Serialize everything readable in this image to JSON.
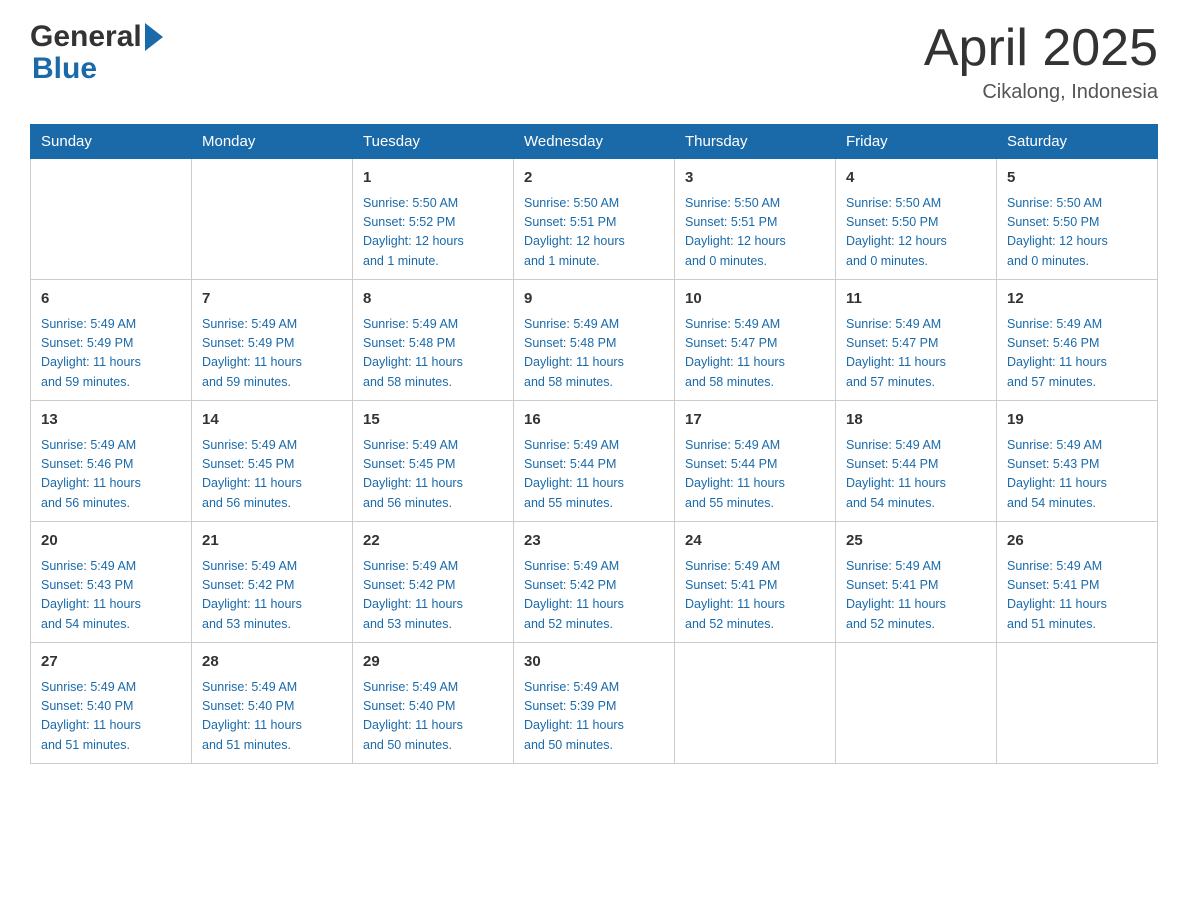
{
  "header": {
    "logo_general": "General",
    "logo_blue": "Blue",
    "title": "April 2025",
    "subtitle": "Cikalong, Indonesia"
  },
  "weekdays": [
    "Sunday",
    "Monday",
    "Tuesday",
    "Wednesday",
    "Thursday",
    "Friday",
    "Saturday"
  ],
  "weeks": [
    [
      {
        "day": "",
        "info": ""
      },
      {
        "day": "",
        "info": ""
      },
      {
        "day": "1",
        "info": "Sunrise: 5:50 AM\nSunset: 5:52 PM\nDaylight: 12 hours\nand 1 minute."
      },
      {
        "day": "2",
        "info": "Sunrise: 5:50 AM\nSunset: 5:51 PM\nDaylight: 12 hours\nand 1 minute."
      },
      {
        "day": "3",
        "info": "Sunrise: 5:50 AM\nSunset: 5:51 PM\nDaylight: 12 hours\nand 0 minutes."
      },
      {
        "day": "4",
        "info": "Sunrise: 5:50 AM\nSunset: 5:50 PM\nDaylight: 12 hours\nand 0 minutes."
      },
      {
        "day": "5",
        "info": "Sunrise: 5:50 AM\nSunset: 5:50 PM\nDaylight: 12 hours\nand 0 minutes."
      }
    ],
    [
      {
        "day": "6",
        "info": "Sunrise: 5:49 AM\nSunset: 5:49 PM\nDaylight: 11 hours\nand 59 minutes."
      },
      {
        "day": "7",
        "info": "Sunrise: 5:49 AM\nSunset: 5:49 PM\nDaylight: 11 hours\nand 59 minutes."
      },
      {
        "day": "8",
        "info": "Sunrise: 5:49 AM\nSunset: 5:48 PM\nDaylight: 11 hours\nand 58 minutes."
      },
      {
        "day": "9",
        "info": "Sunrise: 5:49 AM\nSunset: 5:48 PM\nDaylight: 11 hours\nand 58 minutes."
      },
      {
        "day": "10",
        "info": "Sunrise: 5:49 AM\nSunset: 5:47 PM\nDaylight: 11 hours\nand 58 minutes."
      },
      {
        "day": "11",
        "info": "Sunrise: 5:49 AM\nSunset: 5:47 PM\nDaylight: 11 hours\nand 57 minutes."
      },
      {
        "day": "12",
        "info": "Sunrise: 5:49 AM\nSunset: 5:46 PM\nDaylight: 11 hours\nand 57 minutes."
      }
    ],
    [
      {
        "day": "13",
        "info": "Sunrise: 5:49 AM\nSunset: 5:46 PM\nDaylight: 11 hours\nand 56 minutes."
      },
      {
        "day": "14",
        "info": "Sunrise: 5:49 AM\nSunset: 5:45 PM\nDaylight: 11 hours\nand 56 minutes."
      },
      {
        "day": "15",
        "info": "Sunrise: 5:49 AM\nSunset: 5:45 PM\nDaylight: 11 hours\nand 56 minutes."
      },
      {
        "day": "16",
        "info": "Sunrise: 5:49 AM\nSunset: 5:44 PM\nDaylight: 11 hours\nand 55 minutes."
      },
      {
        "day": "17",
        "info": "Sunrise: 5:49 AM\nSunset: 5:44 PM\nDaylight: 11 hours\nand 55 minutes."
      },
      {
        "day": "18",
        "info": "Sunrise: 5:49 AM\nSunset: 5:44 PM\nDaylight: 11 hours\nand 54 minutes."
      },
      {
        "day": "19",
        "info": "Sunrise: 5:49 AM\nSunset: 5:43 PM\nDaylight: 11 hours\nand 54 minutes."
      }
    ],
    [
      {
        "day": "20",
        "info": "Sunrise: 5:49 AM\nSunset: 5:43 PM\nDaylight: 11 hours\nand 54 minutes."
      },
      {
        "day": "21",
        "info": "Sunrise: 5:49 AM\nSunset: 5:42 PM\nDaylight: 11 hours\nand 53 minutes."
      },
      {
        "day": "22",
        "info": "Sunrise: 5:49 AM\nSunset: 5:42 PM\nDaylight: 11 hours\nand 53 minutes."
      },
      {
        "day": "23",
        "info": "Sunrise: 5:49 AM\nSunset: 5:42 PM\nDaylight: 11 hours\nand 52 minutes."
      },
      {
        "day": "24",
        "info": "Sunrise: 5:49 AM\nSunset: 5:41 PM\nDaylight: 11 hours\nand 52 minutes."
      },
      {
        "day": "25",
        "info": "Sunrise: 5:49 AM\nSunset: 5:41 PM\nDaylight: 11 hours\nand 52 minutes."
      },
      {
        "day": "26",
        "info": "Sunrise: 5:49 AM\nSunset: 5:41 PM\nDaylight: 11 hours\nand 51 minutes."
      }
    ],
    [
      {
        "day": "27",
        "info": "Sunrise: 5:49 AM\nSunset: 5:40 PM\nDaylight: 11 hours\nand 51 minutes."
      },
      {
        "day": "28",
        "info": "Sunrise: 5:49 AM\nSunset: 5:40 PM\nDaylight: 11 hours\nand 51 minutes."
      },
      {
        "day": "29",
        "info": "Sunrise: 5:49 AM\nSunset: 5:40 PM\nDaylight: 11 hours\nand 50 minutes."
      },
      {
        "day": "30",
        "info": "Sunrise: 5:49 AM\nSunset: 5:39 PM\nDaylight: 11 hours\nand 50 minutes."
      },
      {
        "day": "",
        "info": ""
      },
      {
        "day": "",
        "info": ""
      },
      {
        "day": "",
        "info": ""
      }
    ]
  ]
}
